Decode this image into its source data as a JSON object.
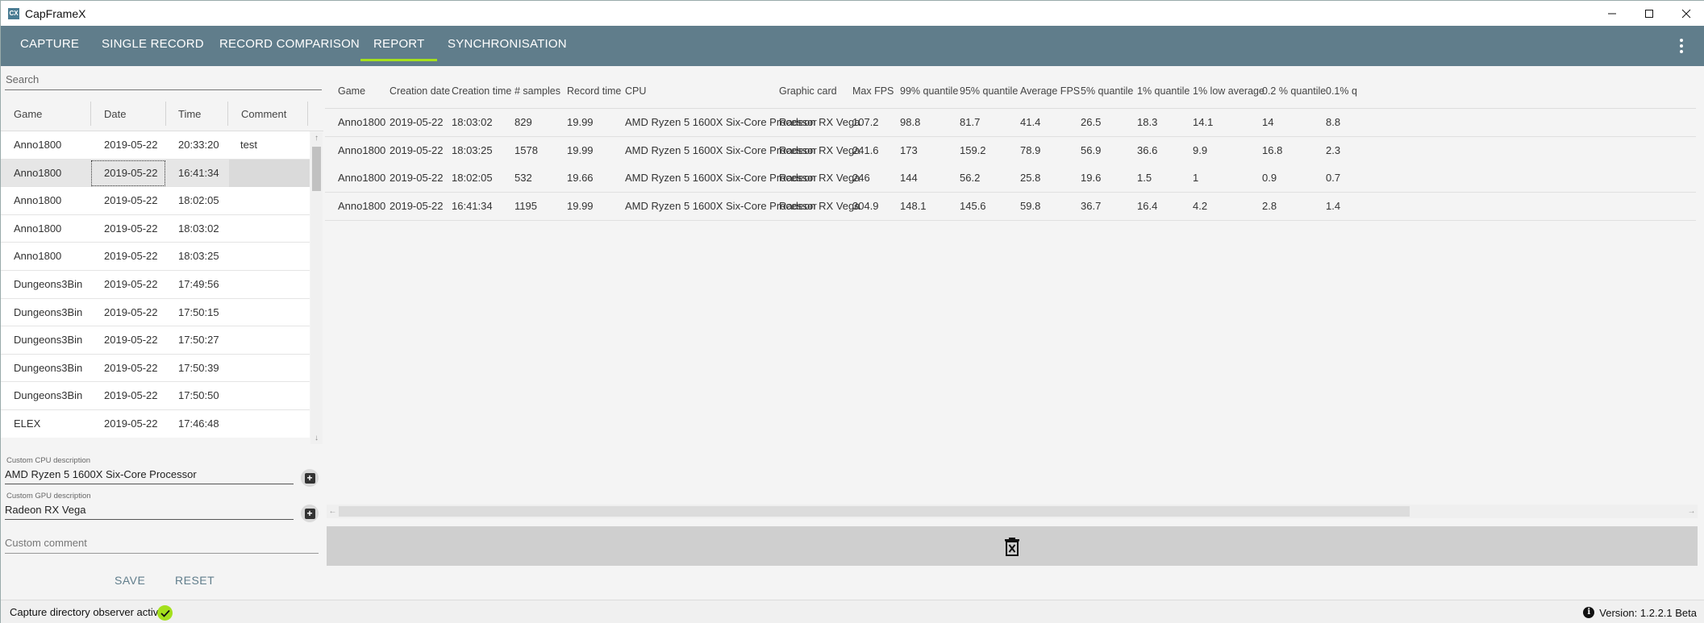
{
  "window": {
    "icon_text": "CX",
    "title": "CapFrameX"
  },
  "nav": {
    "tabs": [
      {
        "label": "CAPTURE"
      },
      {
        "label": "SINGLE RECORD"
      },
      {
        "label": "RECORD COMPARISON"
      },
      {
        "label": "REPORT",
        "active": true
      },
      {
        "label": "SYNCHRONISATION"
      }
    ]
  },
  "records": {
    "search_placeholder": "Search",
    "columns": [
      "Game",
      "Date",
      "Time",
      "Comment"
    ],
    "rows": [
      {
        "game": "Anno1800",
        "date": "2019-05-22",
        "time": "20:33:20",
        "comment": "test"
      },
      {
        "game": "Anno1800",
        "date": "2019-05-22",
        "time": "16:41:34",
        "comment": "",
        "selected": true
      },
      {
        "game": "Anno1800",
        "date": "2019-05-22",
        "time": "18:02:05",
        "comment": ""
      },
      {
        "game": "Anno1800",
        "date": "2019-05-22",
        "time": "18:03:02",
        "comment": ""
      },
      {
        "game": "Anno1800",
        "date": "2019-05-22",
        "time": "18:03:25",
        "comment": ""
      },
      {
        "game": "Dungeons3Bin",
        "date": "2019-05-22",
        "time": "17:49:56",
        "comment": ""
      },
      {
        "game": "Dungeons3Bin",
        "date": "2019-05-22",
        "time": "17:50:15",
        "comment": ""
      },
      {
        "game": "Dungeons3Bin",
        "date": "2019-05-22",
        "time": "17:50:27",
        "comment": ""
      },
      {
        "game": "Dungeons3Bin",
        "date": "2019-05-22",
        "time": "17:50:39",
        "comment": ""
      },
      {
        "game": "Dungeons3Bin",
        "date": "2019-05-22",
        "time": "17:50:50",
        "comment": ""
      },
      {
        "game": "ELEX",
        "date": "2019-05-22",
        "time": "17:46:48",
        "comment": ""
      }
    ]
  },
  "details": {
    "cpu_label": "Custom CPU description",
    "cpu_value": "AMD Ryzen 5 1600X Six-Core Processor",
    "gpu_label": "Custom GPU description",
    "gpu_value": "Radeon RX Vega",
    "comment_placeholder": "Custom comment",
    "save_label": "SAVE",
    "reset_label": "RESET"
  },
  "report": {
    "columns": [
      "Game",
      "Creation date",
      "Creation time",
      "# samples",
      "Record time",
      "CPU",
      "Graphic card",
      "Max FPS",
      "99% quantile",
      "95% quantile",
      "Average FPS",
      "5% quantile",
      "1% quantile",
      "1% low average",
      "0.2 % quantile",
      "0.1% q"
    ],
    "rows": [
      [
        "Anno1800",
        "2019-05-22",
        "18:03:02",
        "829",
        "19.99",
        "AMD Ryzen 5 1600X Six-Core Processor",
        "Radeon RX Vega",
        "107.2",
        "98.8",
        "81.7",
        "41.4",
        "26.5",
        "18.3",
        "14.1",
        "14",
        "8.8"
      ],
      [
        "Anno1800",
        "2019-05-22",
        "18:03:25",
        "1578",
        "19.99",
        "AMD Ryzen 5 1600X Six-Core Processor",
        "Radeon RX Vega",
        "241.6",
        "173",
        "159.2",
        "78.9",
        "56.9",
        "36.6",
        "9.9",
        "16.8",
        "2.3"
      ],
      [
        "Anno1800",
        "2019-05-22",
        "18:02:05",
        "532",
        "19.66",
        "AMD Ryzen 5 1600X Six-Core Processor",
        "Radeon RX Vega",
        "246",
        "144",
        "56.2",
        "25.8",
        "19.6",
        "1.5",
        "1",
        "0.9",
        "0.7"
      ],
      [
        "Anno1800",
        "2019-05-22",
        "16:41:34",
        "1195",
        "19.99",
        "AMD Ryzen 5 1600X Six-Core Processor",
        "Radeon RX Vega",
        "304.9",
        "148.1",
        "145.6",
        "59.8",
        "36.7",
        "16.4",
        "4.2",
        "2.8",
        "1.4"
      ]
    ]
  },
  "status": {
    "observer_text": "Capture directory observer active:",
    "version_text": "Version: 1.2.2.1 Beta"
  },
  "icons": [
    "app-icon",
    "minimize-icon",
    "maximize-icon",
    "close-icon",
    "more-vert-icon",
    "scroll-up-icon",
    "scroll-down-icon",
    "add-icon",
    "scroll-left-icon",
    "scroll-right-icon",
    "delete-icon",
    "check-icon",
    "info-icon"
  ],
  "colors": {
    "nav_bg": "#607d8b",
    "accent": "#a4e01c",
    "selected_row": "#e6e6e6"
  }
}
